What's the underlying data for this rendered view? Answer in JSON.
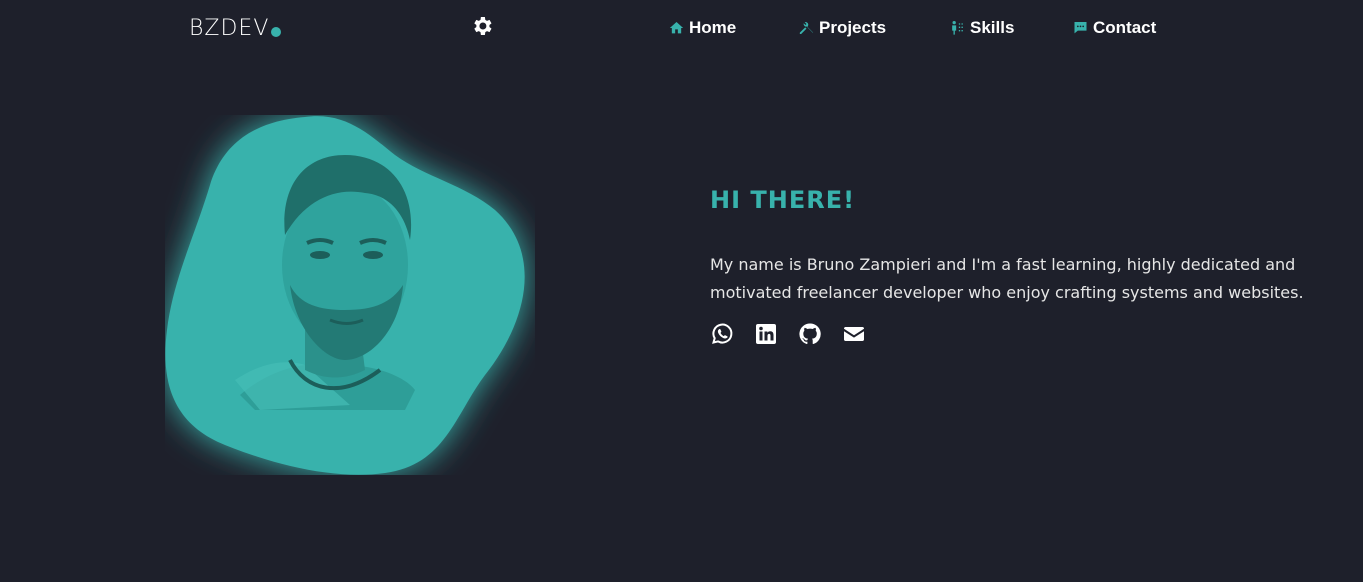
{
  "brand": {
    "logo_text": "BZDEV"
  },
  "nav": {
    "items": [
      {
        "label": "Home",
        "icon": "home-icon"
      },
      {
        "label": "Projects",
        "icon": "tools-icon"
      },
      {
        "label": "Skills",
        "icon": "skills-icon"
      },
      {
        "label": "Contact",
        "icon": "chat-icon"
      }
    ],
    "settings_icon": "gear-icon"
  },
  "hero": {
    "greeting": "HI THERE!",
    "intro": "My name is Bruno Zampieri and I'm a fast learning, highly dedicated and motivated freelancer developer who enjoy crafting systems and websites.",
    "socials": [
      {
        "icon": "whatsapp-icon"
      },
      {
        "icon": "linkedin-icon"
      },
      {
        "icon": "github-icon"
      },
      {
        "icon": "email-icon"
      }
    ]
  },
  "colors": {
    "accent": "#38b2ac",
    "background": "#1e202b",
    "text": "#ffffff"
  }
}
